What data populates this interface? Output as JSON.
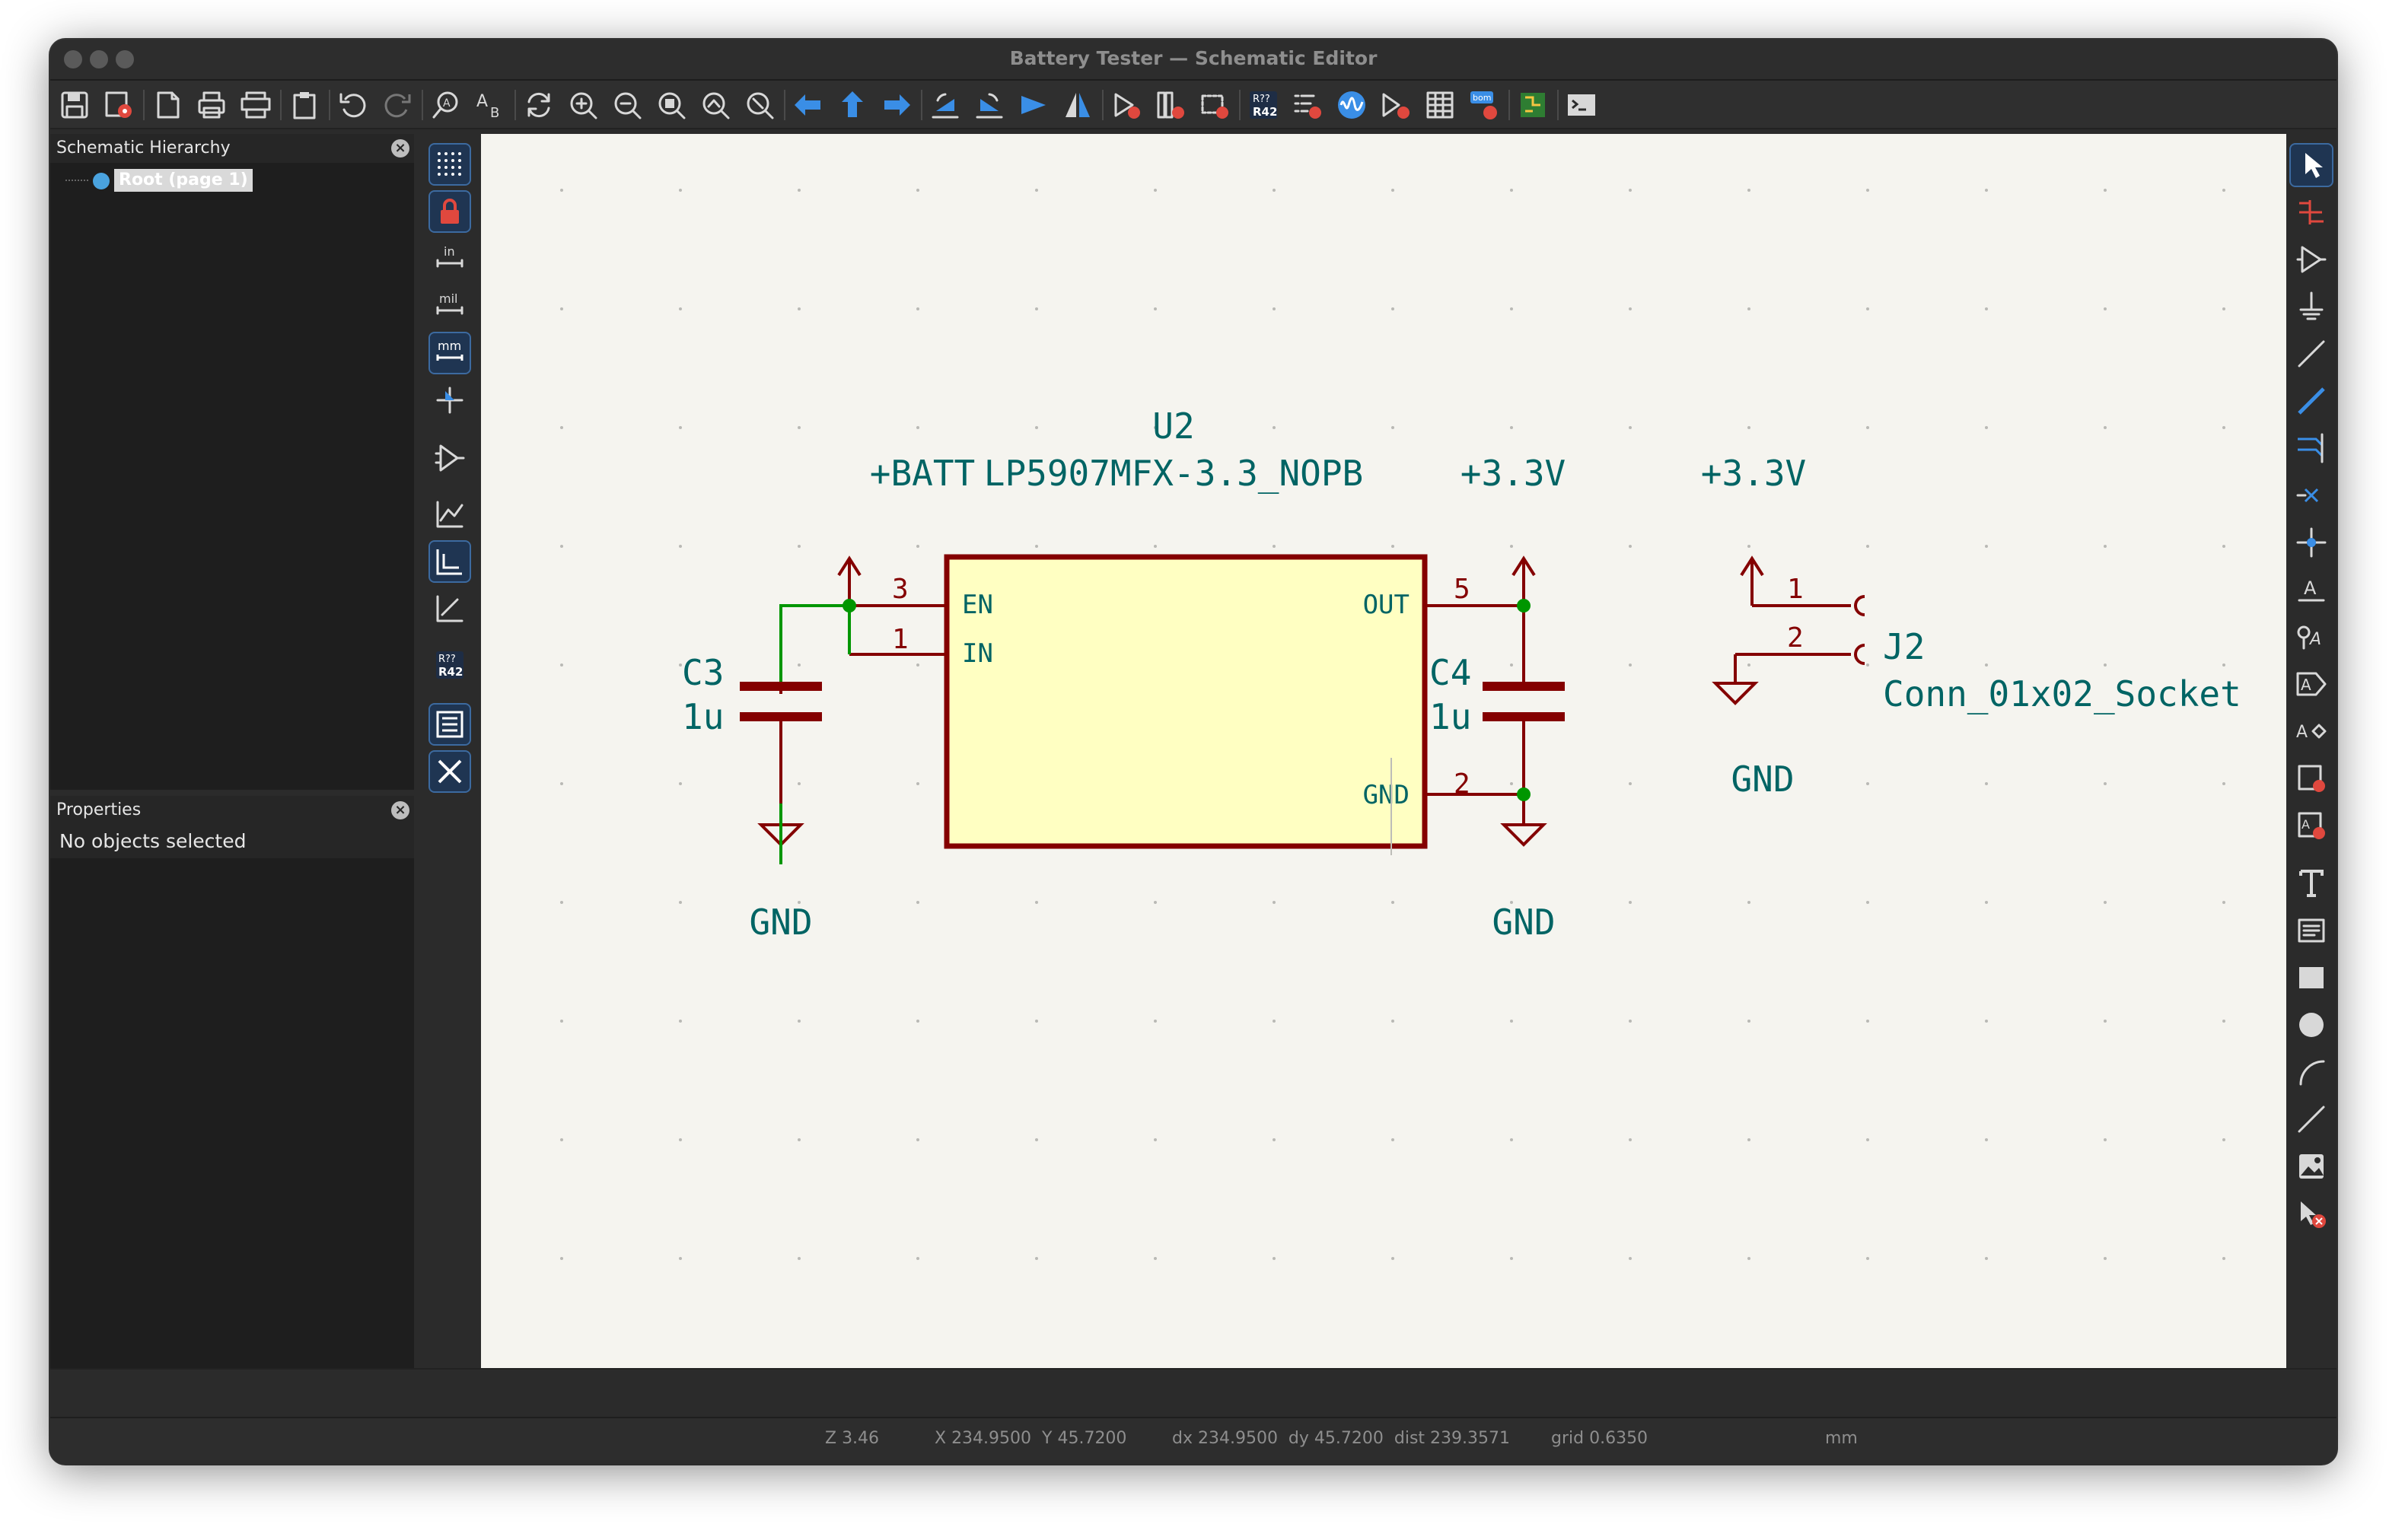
{
  "window": {
    "title": "Battery Tester — Schematic Editor"
  },
  "toolbar": {
    "icons": [
      "save-icon",
      "schematic-setup-icon",
      "page-settings-icon",
      "print-icon",
      "plot-icon",
      "paste-icon",
      "undo-icon",
      "redo-icon",
      "find-icon",
      "find-replace-icon",
      "refresh-icon",
      "zoom-in-icon",
      "zoom-out-icon",
      "zoom-fit-icon",
      "zoom-objects-icon",
      "zoom-selection-icon",
      "navigate-back-icon",
      "navigate-up-icon",
      "navigate-forward-icon",
      "rotate-ccw-icon",
      "rotate-cw-icon",
      "mirror-vertical-icon",
      "mirror-horizontal-icon",
      "symbol-editor-icon",
      "symbol-library-icon",
      "footprint-assign-icon",
      "annotate-icon",
      "erc-icon",
      "simulator-icon",
      "bus-definitions-icon",
      "bom-icon",
      "bom-generate-icon",
      "pcb-editor-icon",
      "scripting-console-icon"
    ]
  },
  "hierarchy": {
    "title": "Schematic Hierarchy",
    "root_label": "Root (page 1)"
  },
  "properties": {
    "title": "Properties",
    "empty_text": "No objects selected"
  },
  "left_toolbar": {
    "unit_in": "in",
    "unit_mil": "mil",
    "unit_mm": "mm",
    "annotate_label": "R??\nR42"
  },
  "schematic": {
    "u2": {
      "ref": "U2",
      "value": "LP5907MFX-3.3_NOPB",
      "pin_en": "EN",
      "pin_in": "IN",
      "pin_out": "OUT",
      "pin_gnd": "GND",
      "pin3": "3",
      "pin1": "1",
      "pin5": "5",
      "pin2": "2"
    },
    "power_batt": "+BATT",
    "power_33_a": "+3.3V",
    "power_33_b": "+3.3V",
    "c3": {
      "ref": "C3",
      "value": "1u"
    },
    "c4": {
      "ref": "C4",
      "value": "1u"
    },
    "gnd_1": "GND",
    "gnd_2": "GND",
    "gnd_3": "GND",
    "j2": {
      "ref": "J2",
      "value": "Conn_01x02_Socket",
      "pin1": "1",
      "pin2": "2"
    },
    "colors": {
      "wire": "#009600",
      "component": "#840000",
      "text": "#006464",
      "body": "#ffffc2",
      "junction": "#009600"
    }
  },
  "status": {
    "zoom": "Z 3.46",
    "xy": "X 234.9500  Y 45.7200",
    "delta": "dx 234.9500  dy 45.7200  dist 239.3571",
    "grid": "grid 0.6350",
    "units": "mm"
  }
}
